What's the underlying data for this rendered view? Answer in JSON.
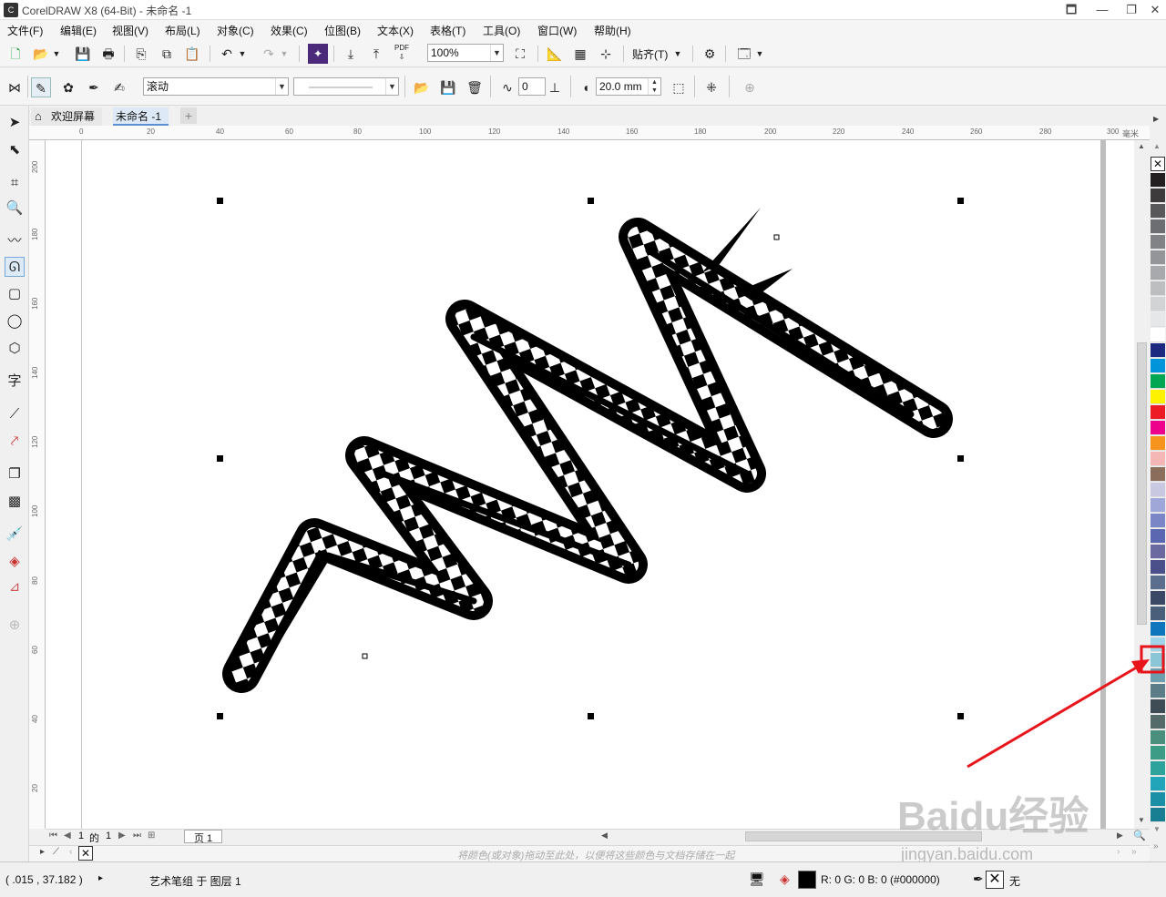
{
  "titlebar": {
    "title": "CorelDRAW X8 (64-Bit) - 未命名 -1",
    "btn_restore_dn": "🗖",
    "btn_min": "—",
    "btn_max": "❐",
    "btn_close": "✕"
  },
  "menu": [
    "文件(F)",
    "编辑(E)",
    "视图(V)",
    "布局(L)",
    "对象(C)",
    "效果(C)",
    "位图(B)",
    "文本(X)",
    "表格(T)",
    "工具(O)",
    "窗口(W)",
    "帮助(H)"
  ],
  "standard_toolbar": {
    "zoom_value": "100%",
    "snap_label": "贴齐(T)"
  },
  "property_bar": {
    "mode_value": "滚动",
    "smoothing_value": "0",
    "width_value": "20.0 mm"
  },
  "tabs": {
    "welcome": "欢迎屏幕",
    "document": "未命名 -1"
  },
  "rulers": {
    "h_ticks": [
      "0",
      "20",
      "40",
      "60",
      "80",
      "100",
      "120",
      "140",
      "160",
      "180",
      "200",
      "220",
      "240",
      "260",
      "280",
      "300"
    ],
    "h_unit": "毫米",
    "v_ticks": [
      "200",
      "180",
      "160",
      "140",
      "120",
      "100",
      "80",
      "60",
      "40",
      "20"
    ]
  },
  "page_nav": {
    "current": "1",
    "of": "的",
    "total": "1",
    "page_tab": "页 1"
  },
  "doc_palette_hint": "将颜色(或对象)拖动至此处，以便将这些颜色与文档存储在一起",
  "status": {
    "coords": "( .015 , 37.182 )",
    "object_info": "艺术笔组 于 图层 1",
    "fill_info": "R: 0 G: 0 B: 0 (#000000)",
    "outline_info": "无"
  },
  "watermark": {
    "text": "Baidu经验",
    "sub": "jingyan.baidu.com"
  },
  "palette_colors": [
    "#231f20",
    "#3d3b3c",
    "#58585a",
    "#6d6e71",
    "#808285",
    "#939598",
    "#a7a9ac",
    "#bcbec0",
    "#d1d3d4",
    "#e6e7e8",
    "#ffffff",
    "#1b2a80",
    "#0095da",
    "#00a651",
    "#fff200",
    "#ed1c24",
    "#ec008c",
    "#f7941d",
    "#f5b6b6",
    "#8b6d5c",
    "#c8c8e0",
    "#9ea7d8",
    "#7b86c7",
    "#5b67b1",
    "#6b6aa0",
    "#4b4f8a",
    "#5b6e8e",
    "#3a4866",
    "#4a5f7a",
    "#0f75bc",
    "#a0d4e8",
    "#8bc6d6",
    "#6b9fae",
    "#5c7d88",
    "#3e4d55",
    "#556b6a",
    "#4a8f7d",
    "#3d9c86",
    "#2ea39c",
    "#22a5b8",
    "#1a8fa6",
    "#177f91"
  ]
}
